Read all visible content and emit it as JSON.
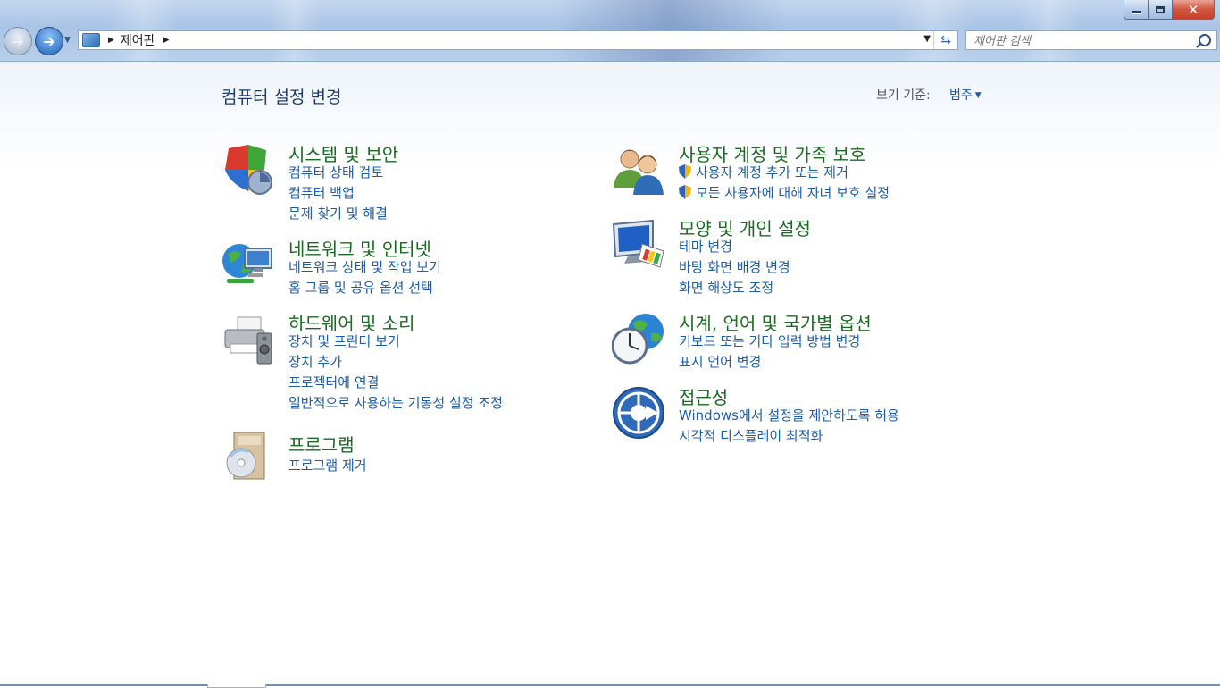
{
  "window": {
    "minimize_label": "",
    "close_label": "✕"
  },
  "address": {
    "crumb": "제어판",
    "search_placeholder": "제어판 검색"
  },
  "page": {
    "title": "컴퓨터 설정 변경",
    "viewby_label": "보기 기준:",
    "viewby_value": "범주"
  },
  "categories": [
    {
      "heading": "시스템 및 보안",
      "icon": "shield-icon",
      "links": [
        "컴퓨터 상태 검토",
        "컴퓨터 백업",
        "문제 찾기 및 해결"
      ]
    },
    {
      "heading": "네트워크 및 인터넷",
      "icon": "network-icon",
      "links": [
        "네트워크 상태 및 작업 보기",
        "홈 그룹 및 공유 옵션 선택"
      ]
    },
    {
      "heading": "하드웨어 및 소리",
      "icon": "printer-icon",
      "links": [
        "장치 및 프린터 보기",
        "장치 추가",
        "프로젝터에 연결",
        "일반적으로 사용하는 기동성 설정 조정"
      ]
    },
    {
      "heading": "프로그램",
      "icon": "programs-icon",
      "links": [
        "프로그램 제거"
      ]
    },
    {
      "heading": "사용자 계정 및 가족 보호",
      "icon": "users-icon",
      "links": [
        "사용자 계정 추가 또는 제거",
        "모든 사용자에 대해 자녀 보호 설정"
      ]
    },
    {
      "heading": "모양 및 개인 설정",
      "icon": "monitor-icon",
      "links": [
        "테마 변경",
        "바탕 화면 배경 변경",
        "화면 해상도 조정"
      ]
    },
    {
      "heading": "시계, 언어 및 국가별 옵션",
      "icon": "clock-globe-icon",
      "links": [
        "키보드 또는 기타 입력 방법 변경",
        "표시 언어 변경"
      ]
    },
    {
      "heading": "접근성",
      "icon": "accessibility-icon",
      "links": [
        "Windows에서 설정을 제안하도록 허용",
        "시각적 디스플레이 최적화"
      ]
    }
  ],
  "colors": {
    "heading_green": "#1b6b22",
    "link_blue": "#1d5ea8",
    "title_blue": "#1e3a6e"
  }
}
